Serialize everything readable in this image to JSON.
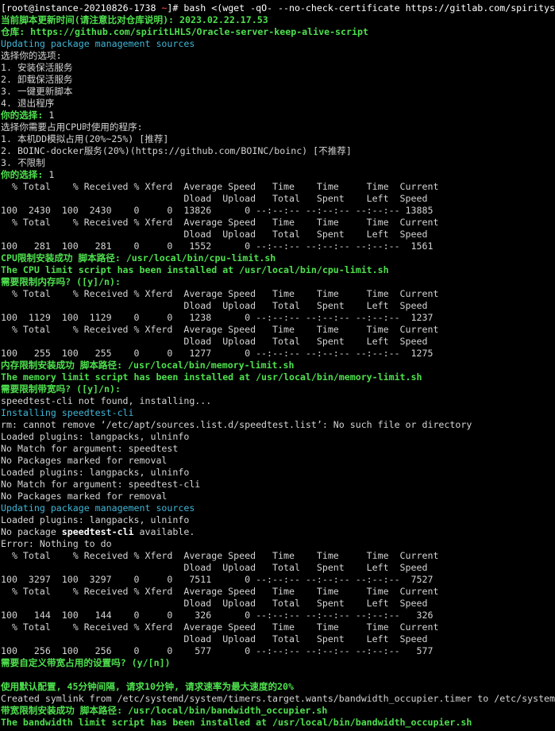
{
  "prompt": {
    "open": "[",
    "user_host": "root@instance-20210826-1738",
    "cwd": " ~",
    "close": "]",
    "command": "# bash <(wget -qO- --no-check-certificate https://gitlab.com/spiritys"
  },
  "lines": [
    {
      "c": "g",
      "t": "当前脚本更新时间(请注意比对仓库说明): 2023.02.22.17.53"
    },
    {
      "c": "g",
      "t": "仓库: https://github.com/spiritLHLS/Oracle-server-keep-alive-script"
    },
    {
      "c": "c",
      "t": "Updating package management sources"
    },
    {
      "c": "",
      "t": "选择你的选项:"
    },
    {
      "c": "",
      "t": "1. 安装保活服务"
    },
    {
      "c": "",
      "t": "2. 卸载保活服务"
    },
    {
      "c": "",
      "t": "3. 一键更新脚本"
    },
    {
      "c": "",
      "t": "4. 退出程序"
    },
    {
      "c": "g",
      "t": "你的选择: ",
      "tail": "1"
    },
    {
      "c": "",
      "t": "选择你需要占用CPU时使用的程序:"
    },
    {
      "c": "",
      "t": "1. 本机DD模拟占用(20%~25%) [推荐]"
    },
    {
      "c": "",
      "t": "2. BOINC-docker服务(20%)(https://github.com/BOINC/boinc) [不推荐]"
    },
    {
      "c": "",
      "t": "3. 不限制"
    },
    {
      "c": "g",
      "t": "你的选择: ",
      "tail": "1"
    },
    {
      "c": "",
      "t": "  % Total    % Received % Xferd  Average Speed   Time    Time     Time  Current"
    },
    {
      "c": "",
      "t": "                                 Dload  Upload   Total   Spent    Left  Speed"
    },
    {
      "c": "",
      "t": "100  2430  100  2430    0     0  13826      0 --:--:-- --:--:-- --:--:-- 13885"
    },
    {
      "c": "",
      "t": "  % Total    % Received % Xferd  Average Speed   Time    Time     Time  Current"
    },
    {
      "c": "",
      "t": "                                 Dload  Upload   Total   Spent    Left  Speed"
    },
    {
      "c": "",
      "t": "100   281  100   281    0     0   1552      0 --:--:-- --:--:-- --:--:--  1561"
    },
    {
      "c": "g",
      "t": "CPU限制安装成功 脚本路径: /usr/local/bin/cpu-limit.sh"
    },
    {
      "c": "g",
      "t": "The CPU limit script has been installed at /usr/local/bin/cpu-limit.sh"
    },
    {
      "c": "g",
      "t": "需要限制内存吗? ([y]/n): "
    },
    {
      "c": "",
      "t": "  % Total    % Received % Xferd  Average Speed   Time    Time     Time  Current"
    },
    {
      "c": "",
      "t": "                                 Dload  Upload   Total   Spent    Left  Speed"
    },
    {
      "c": "",
      "t": "100  1129  100  1129    0     0   1238      0 --:--:-- --:--:-- --:--:--  1237"
    },
    {
      "c": "",
      "t": "  % Total    % Received % Xferd  Average Speed   Time    Time     Time  Current"
    },
    {
      "c": "",
      "t": "                                 Dload  Upload   Total   Spent    Left  Speed"
    },
    {
      "c": "",
      "t": "100   255  100   255    0     0   1277      0 --:--:-- --:--:-- --:--:--  1275"
    },
    {
      "c": "g",
      "t": "内存限制安装成功 脚本路径: /usr/local/bin/memory-limit.sh"
    },
    {
      "c": "g",
      "t": "The memory limit script has been installed at /usr/local/bin/memory-limit.sh"
    },
    {
      "c": "g",
      "t": "需要限制带宽吗? ([y]/n): "
    },
    {
      "c": "",
      "t": "speedtest-cli not found, installing..."
    },
    {
      "c": "c",
      "t": "Installing speedtest-cli"
    },
    {
      "c": "",
      "t": "rm: cannot remove ‘/etc/apt/sources.list.d/speedtest.list’: No such file or directory"
    },
    {
      "c": "",
      "t": "Loaded plugins: langpacks, ulninfo"
    },
    {
      "c": "",
      "t": "No Match for argument: speedtest"
    },
    {
      "c": "",
      "t": "No Packages marked for removal"
    },
    {
      "c": "",
      "t": "Loaded plugins: langpacks, ulninfo"
    },
    {
      "c": "",
      "t": "No Match for argument: speedtest-cli"
    },
    {
      "c": "",
      "t": "No Packages marked for removal"
    },
    {
      "c": "c",
      "t": "Updating package management sources"
    },
    {
      "c": "",
      "t": "Loaded plugins: langpacks, ulninfo"
    },
    {
      "c": "",
      "t": "No package ",
      "bold": "speedtest-cli",
      "tail": " available."
    },
    {
      "c": "",
      "t": "Error: Nothing to do"
    },
    {
      "c": "",
      "t": "  % Total    % Received % Xferd  Average Speed   Time    Time     Time  Current"
    },
    {
      "c": "",
      "t": "                                 Dload  Upload   Total   Spent    Left  Speed"
    },
    {
      "c": "",
      "t": "100  3297  100  3297    0     0   7511      0 --:--:-- --:--:-- --:--:--  7527"
    },
    {
      "c": "",
      "t": "  % Total    % Received % Xferd  Average Speed   Time    Time     Time  Current"
    },
    {
      "c": "",
      "t": "                                 Dload  Upload   Total   Spent    Left  Speed"
    },
    {
      "c": "",
      "t": "100   144  100   144    0     0    326      0 --:--:-- --:--:-- --:--:--   326"
    },
    {
      "c": "",
      "t": "  % Total    % Received % Xferd  Average Speed   Time    Time     Time  Current"
    },
    {
      "c": "",
      "t": "                                 Dload  Upload   Total   Spent    Left  Speed"
    },
    {
      "c": "",
      "t": "100   256  100   256    0     0    577      0 --:--:-- --:--:-- --:--:--   577"
    },
    {
      "c": "g",
      "t": "需要自定义带宽占用的设置吗? (y/[n]) "
    },
    {
      "c": "",
      "t": ""
    },
    {
      "c": "g",
      "t": "使用默认配置, 45分钟间隔, 请求10分钟, 请求速率为最大速度的20%"
    },
    {
      "c": "",
      "t": "Created symlink from /etc/systemd/system/timers.target.wants/bandwidth_occupier.timer to /etc/system"
    },
    {
      "c": "g",
      "t": "带宽限制安装成功 脚本路径: /usr/local/bin/bandwidth_occupier.sh"
    },
    {
      "c": "g",
      "t": "The bandwidth limit script has been installed at /usr/local/bin/bandwidth_occupier.sh"
    }
  ],
  "colors": {
    "background": "#000000",
    "text": "#d4d4d4",
    "green": "#4ee04e",
    "cyan": "#3fb6d6",
    "red_host": "#ff4d4d"
  }
}
